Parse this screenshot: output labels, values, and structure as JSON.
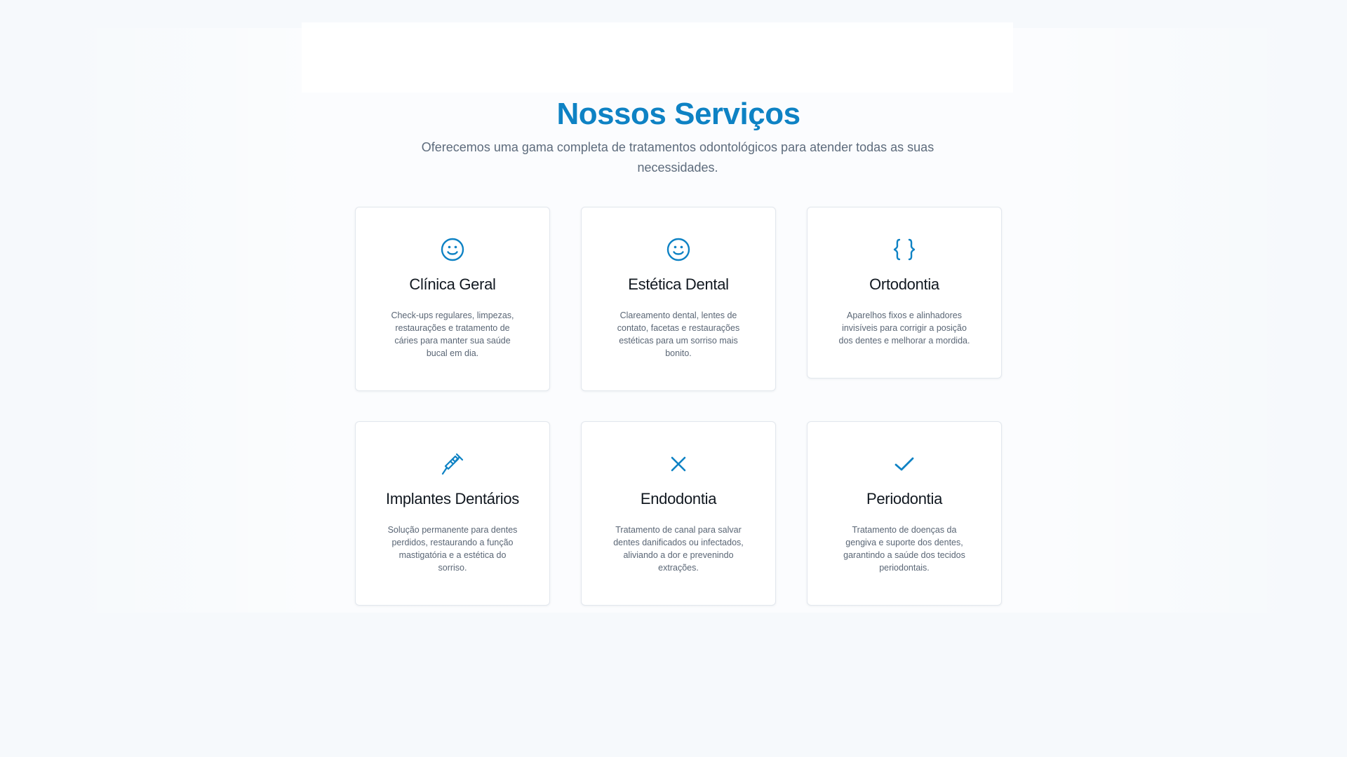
{
  "header": {
    "title": "Nossos Serviços",
    "subtitle": "Oferecemos uma gama completa de tratamentos odontológicos para atender todas as suas necessidades."
  },
  "colors": {
    "accent": "#0e82c4",
    "background": "#f6f9fc",
    "card": "#ffffff",
    "text": "#111820",
    "muted": "#5a6675"
  },
  "services": [
    {
      "icon": "smile-icon",
      "title": "Clínica Geral",
      "description": "Check-ups regulares, limpezas, restaurações e tratamento de cáries para manter sua saúde bucal em dia."
    },
    {
      "icon": "smile-icon",
      "title": "Estética Dental",
      "description": "Clareamento dental, lentes de contato, facetas e restaurações estéticas para um sorriso mais bonito."
    },
    {
      "icon": "braces-icon",
      "title": "Ortodontia",
      "description": "Aparelhos fixos e alinhadores invisíveis para corrigir a posição dos dentes e melhorar a mordida."
    },
    {
      "icon": "syringe-icon",
      "title": "Implantes Dentários",
      "description": "Solução permanente para dentes perdidos, restaurando a função mastigatória e a estética do sorriso."
    },
    {
      "icon": "x-icon",
      "title": "Endodontia",
      "description": "Tratamento de canal para salvar dentes danificados ou infectados, aliviando a dor e prevenindo extrações."
    },
    {
      "icon": "check-icon",
      "title": "Periodontia",
      "description": "Tratamento de doenças da gengiva e suporte dos dentes, garantindo a saúde dos tecidos periodontais."
    }
  ]
}
